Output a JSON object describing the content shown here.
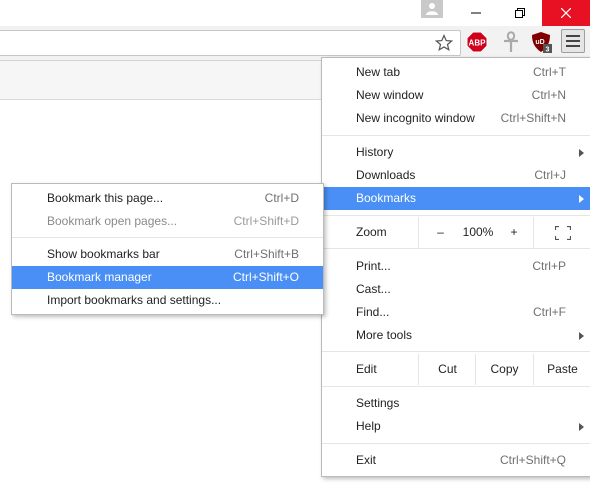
{
  "window": {
    "controls": [
      "minimize",
      "restore",
      "close"
    ],
    "close_color": "#e81123"
  },
  "toolbar": {
    "extensions": [
      {
        "name": "abp-icon",
        "label": "ABP"
      },
      {
        "name": "ankh-icon"
      },
      {
        "name": "ublock-icon",
        "label": "uD",
        "badge": "3"
      }
    ]
  },
  "main_menu": {
    "new_tab": {
      "label": "New tab",
      "shortcut": "Ctrl+T"
    },
    "new_window": {
      "label": "New window",
      "shortcut": "Ctrl+N"
    },
    "new_incognito": {
      "label": "New incognito window",
      "shortcut": "Ctrl+Shift+N"
    },
    "history": {
      "label": "History"
    },
    "downloads": {
      "label": "Downloads",
      "shortcut": "Ctrl+J"
    },
    "bookmarks": {
      "label": "Bookmarks"
    },
    "zoom": {
      "label": "Zoom",
      "minus": "–",
      "value": "100%",
      "plus": "+"
    },
    "print": {
      "label": "Print...",
      "shortcut": "Ctrl+P"
    },
    "cast": {
      "label": "Cast..."
    },
    "find": {
      "label": "Find...",
      "shortcut": "Ctrl+F"
    },
    "more_tools": {
      "label": "More tools"
    },
    "edit": {
      "label": "Edit",
      "cut": "Cut",
      "copy": "Copy",
      "paste": "Paste"
    },
    "settings": {
      "label": "Settings"
    },
    "help": {
      "label": "Help"
    },
    "exit": {
      "label": "Exit",
      "shortcut": "Ctrl+Shift+Q"
    }
  },
  "bookmarks_submenu": {
    "bookmark_page": {
      "label": "Bookmark this page...",
      "shortcut": "Ctrl+D"
    },
    "bookmark_open_pages": {
      "label": "Bookmark open pages...",
      "shortcut": "Ctrl+Shift+D",
      "disabled": true
    },
    "show_bar": {
      "label": "Show bookmarks bar",
      "shortcut": "Ctrl+Shift+B"
    },
    "manager": {
      "label": "Bookmark manager",
      "shortcut": "Ctrl+Shift+O"
    },
    "import": {
      "label": "Import bookmarks and settings..."
    }
  },
  "colors": {
    "highlight": "#4a8ff5",
    "abp_red": "#d0021b",
    "ublock_red": "#800000"
  }
}
